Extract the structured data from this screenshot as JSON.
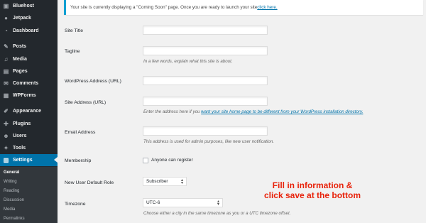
{
  "sidebar": {
    "items": [
      {
        "label": "Bluehost",
        "icon": "bluehost-icon",
        "glyph": "▣"
      },
      {
        "label": "Jetpack",
        "icon": "jetpack-icon",
        "glyph": "●"
      },
      {
        "label": "Dashboard",
        "icon": "dashboard-icon",
        "glyph": "◔"
      },
      {
        "label": "Posts",
        "icon": "pin-icon",
        "glyph": "✎"
      },
      {
        "label": "Media",
        "icon": "media-icon",
        "glyph": "♫"
      },
      {
        "label": "Pages",
        "icon": "pages-icon",
        "glyph": "▤"
      },
      {
        "label": "Comments",
        "icon": "comments-icon",
        "glyph": "✉"
      },
      {
        "label": "WPForms",
        "icon": "wpforms-icon",
        "glyph": "▦"
      },
      {
        "label": "Appearance",
        "icon": "paintbrush-icon",
        "glyph": "✐"
      },
      {
        "label": "Plugins",
        "icon": "plugins-icon",
        "glyph": "✚"
      },
      {
        "label": "Users",
        "icon": "users-icon",
        "glyph": "☻"
      },
      {
        "label": "Tools",
        "icon": "tools-icon",
        "glyph": "✦"
      },
      {
        "label": "Settings",
        "icon": "settings-icon",
        "glyph": "▥"
      }
    ],
    "submenu": [
      "General",
      "Writing",
      "Reading",
      "Discussion",
      "Media",
      "Permalinks"
    ],
    "active_color": "#0073aa"
  },
  "notice": {
    "text": "Your site is currently displaying a \"Coming Soon\" page. Once you are ready to launch your site ",
    "link": "click here."
  },
  "form": {
    "site_title": {
      "label": "Site Title",
      "value": ""
    },
    "tagline": {
      "label": "Tagline",
      "value": "",
      "description": "In a few words, explain what this site is about."
    },
    "wp_address": {
      "label": "WordPress Address (URL)",
      "value": ""
    },
    "site_address": {
      "label": "Site Address (URL)",
      "value": "",
      "description_prefix": "Enter the address here if you ",
      "description_link": "want your site home page to be different from your WordPress installation directory."
    },
    "email": {
      "label": "Email Address",
      "value": "",
      "description": "This address is used for admin purposes, like new user notification."
    },
    "membership": {
      "label": "Membership",
      "checkbox_label": "Anyone can register",
      "checked": false
    },
    "default_role": {
      "label": "New User Default Role",
      "selected": "Subscriber"
    },
    "timezone": {
      "label": "Timezone",
      "selected": "UTC-6",
      "description": "Choose either a city in the same timezone as you or a UTC timezone offset."
    }
  },
  "annotation": {
    "line1": "Fill in information &",
    "line2": "click save at the bottom",
    "color": "#e8220a"
  }
}
